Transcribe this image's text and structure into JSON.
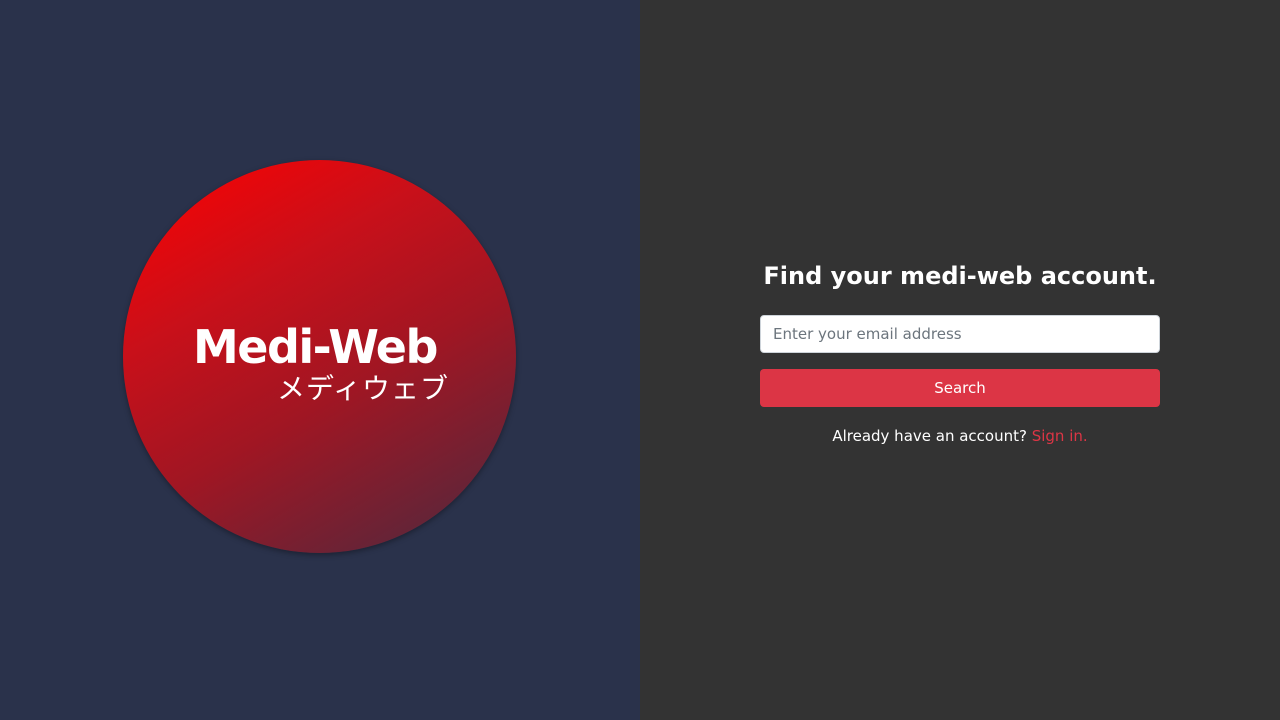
{
  "brand": {
    "name": "Medi-Web",
    "name_japanese": "メディウェブ",
    "colors": {
      "left_background": "#2a324b",
      "right_background": "#333333",
      "accent": "#dc3545",
      "logo_gradient_start": "#ff0000",
      "logo_gradient_end": "#4a2a40"
    }
  },
  "form": {
    "title": "Find your medi-web account.",
    "email_placeholder": "Enter your email address",
    "email_value": "",
    "search_label": "Search",
    "signin_prompt": "Already have an account?",
    "signin_link": "Sign in."
  }
}
